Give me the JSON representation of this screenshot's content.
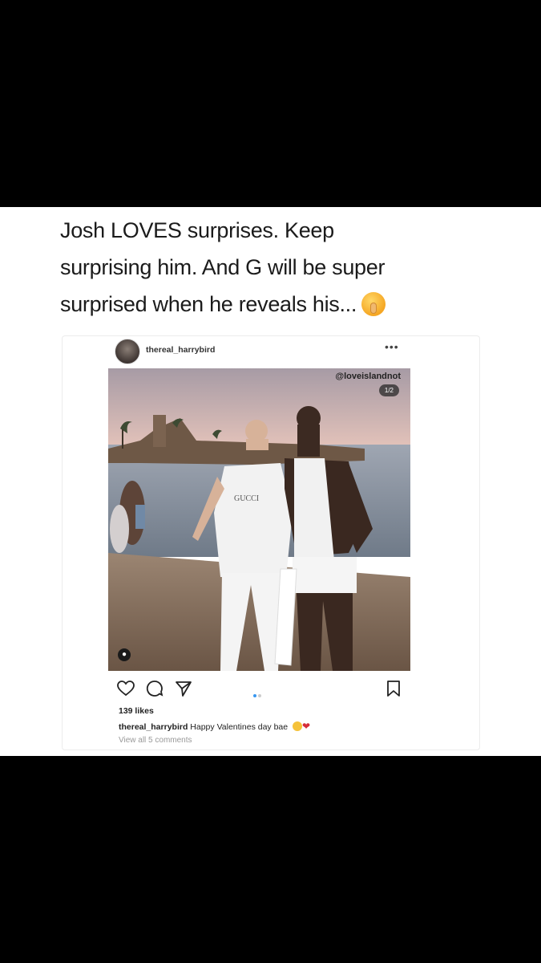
{
  "tweet": {
    "line1": "Josh LOVES surprises. Keep",
    "line2": "surprising him. And G will be super",
    "line3": "surprised when he reveals his...",
    "emoji": "shushing-face-emoji"
  },
  "post": {
    "username": "thereal_harrybird",
    "more_icon": "more-dots-icon",
    "watermark": "@loveislandnot",
    "counter": "1/2",
    "likes": "139 likes",
    "caption_user": "thereal_harrybird",
    "caption_text": "Happy Valentines day bae",
    "view_comments": "View all 5 comments",
    "icons": [
      "heart-icon",
      "comment-icon",
      "share-icon",
      "bookmark-icon",
      "user-tag-icon"
    ],
    "photo_text": "GUCCI"
  }
}
